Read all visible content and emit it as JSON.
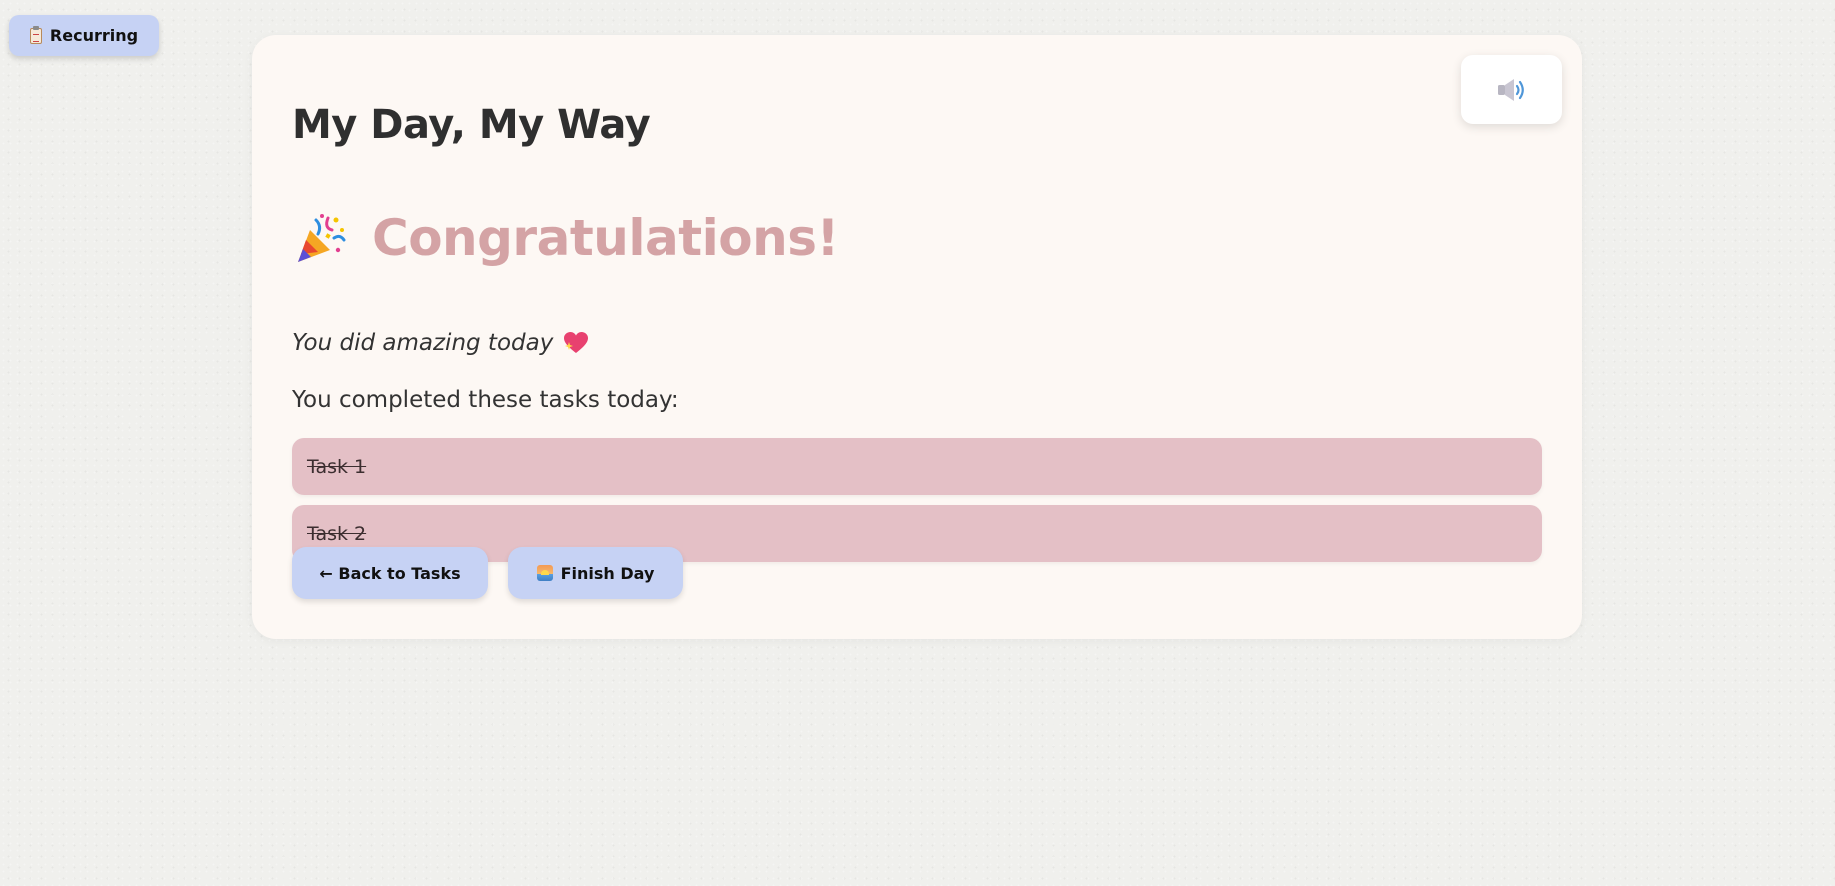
{
  "floating": {
    "recurring_label": "Recurring",
    "recurring_icon": "clipboard-icon"
  },
  "card": {
    "title": "My Day, My Way",
    "sound_icon": "speaker-icon",
    "congrats": {
      "icon": "party-popper-icon",
      "heading": "Congratulations!",
      "subtitle": "You did amazing today",
      "subtitle_icon": "sparkling-heart-icon"
    },
    "completed_label": "You completed these tasks today:",
    "tasks": [
      {
        "label": "Task 1",
        "completed": true
      },
      {
        "label": "Task 2",
        "completed": true
      }
    ],
    "buttons": {
      "back_label": "← Back to Tasks",
      "finish_label": "Finish Day",
      "finish_icon": "sunrise-icon"
    }
  },
  "colors": {
    "background": "#f0f0ed",
    "card": "#fdf8f4",
    "accent_button": "#c6d2f4",
    "task_item": "#e4c0c6",
    "congrats_heading": "#d4a3a5",
    "title_text": "#2f2f2f"
  }
}
